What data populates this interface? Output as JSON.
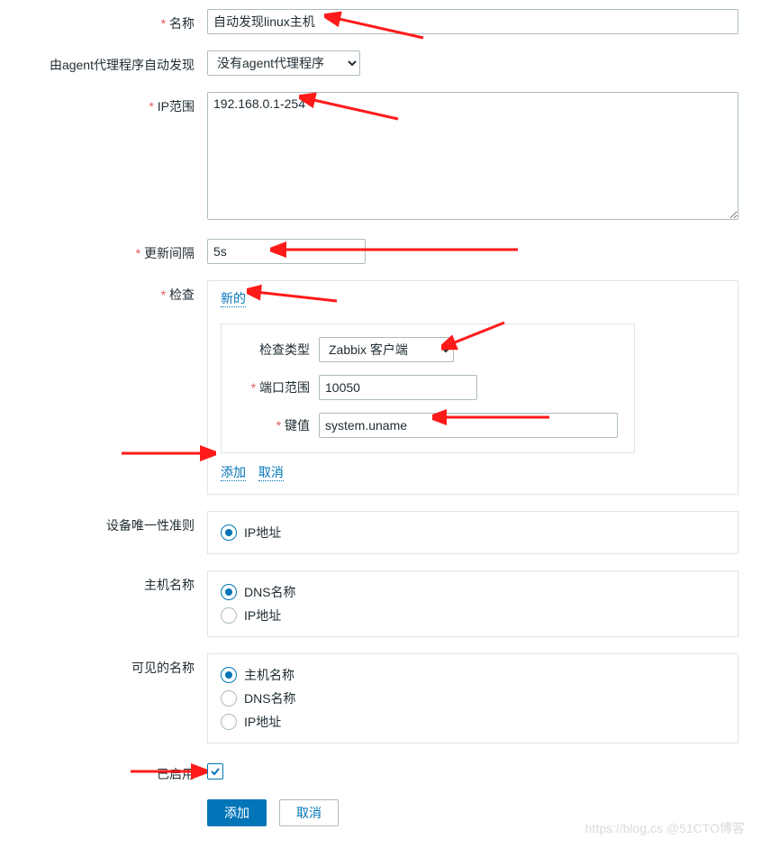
{
  "labels": {
    "name": "名称",
    "proxy": "由agent代理程序自动发现",
    "ip_range": "IP范围",
    "interval": "更新间隔",
    "checks": "检查",
    "check_type": "检查类型",
    "port_range": "端口范围",
    "key": "键值",
    "uniqueness": "设备唯一性准则",
    "host_name": "主机名称",
    "visible_name": "可见的名称",
    "enabled": "已启用"
  },
  "values": {
    "name": "自动发现linux主机",
    "proxy_selected": "没有agent代理程序",
    "ip_range": "192.168.0.1-254",
    "interval": "5s",
    "check_type_selected": "Zabbix 客户端",
    "port_range": "10050",
    "key": "system.uname",
    "enabled": true
  },
  "links": {
    "new_check": "新的",
    "add_check": "添加",
    "cancel_check": "取消"
  },
  "radios": {
    "uniqueness": {
      "options": [
        {
          "label": "IP地址",
          "selected": true
        }
      ]
    },
    "host_name": {
      "options": [
        {
          "label": "DNS名称",
          "selected": true
        },
        {
          "label": "IP地址",
          "selected": false
        }
      ]
    },
    "visible_name": {
      "options": [
        {
          "label": "主机名称",
          "selected": true
        },
        {
          "label": "DNS名称",
          "selected": false
        },
        {
          "label": "IP地址",
          "selected": false
        }
      ]
    }
  },
  "buttons": {
    "submit": "添加",
    "cancel": "取消"
  },
  "watermark": "https://blog.cs   @51CTO博客",
  "colors": {
    "accent": "#0275b8",
    "required": "#e45959",
    "border": "#acbbc2",
    "panel_border": "#dfe4e7"
  }
}
